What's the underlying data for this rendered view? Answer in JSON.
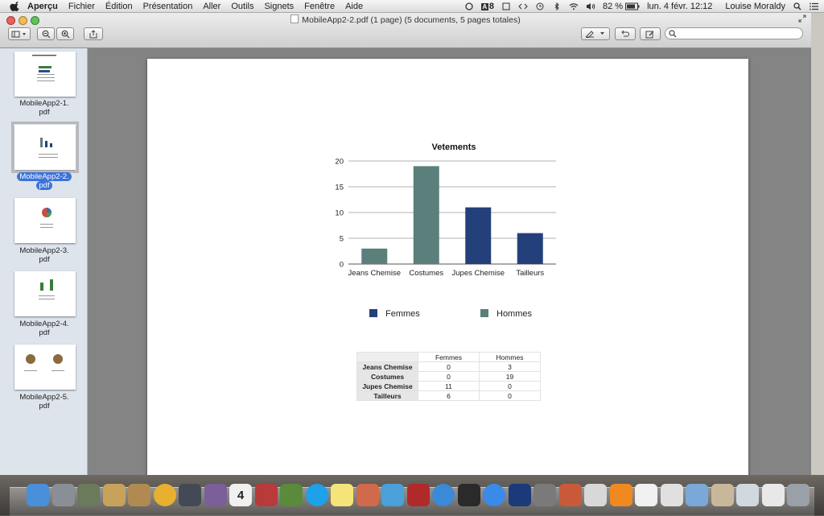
{
  "menubar": {
    "app": "Aperçu",
    "items": [
      "Fichier",
      "Édition",
      "Présentation",
      "Aller",
      "Outils",
      "Signets",
      "Fenêtre",
      "Aide"
    ],
    "status": {
      "badge": "8",
      "battery": "82 %",
      "datetime": "lun. 4 févr.  12:12",
      "user": "Louise Moraldy"
    }
  },
  "window": {
    "title": "MobileApp2-2.pdf (1 page) (5 documents, 5 pages totales)"
  },
  "sidebar": {
    "items": [
      {
        "label_line1": "MobileApp2-1.",
        "label_line2": "pdf"
      },
      {
        "label_line1": "MobileApp2-2.",
        "label_line2": "pdf"
      },
      {
        "label_line1": "MobileApp2-3.",
        "label_line2": "pdf"
      },
      {
        "label_line1": "MobileApp2-4.",
        "label_line2": "pdf"
      },
      {
        "label_line1": "MobileApp2-5.",
        "label_line2": "pdf"
      }
    ],
    "selected_index": 1
  },
  "chart_data": {
    "type": "bar",
    "title": "Vetements",
    "categories": [
      "Jeans Chemise",
      "Costumes",
      "Jupes Chemise",
      "Tailleurs"
    ],
    "series": [
      {
        "name": "Femmes",
        "values": [
          0,
          0,
          11,
          6
        ],
        "color": "#24407a"
      },
      {
        "name": "Hommes",
        "values": [
          3,
          19,
          0,
          0
        ],
        "color": "#5b7f7b"
      }
    ],
    "ylim": [
      0,
      20
    ],
    "yticks": [
      0,
      5,
      10,
      15,
      20
    ],
    "grid": true,
    "legend": "bottom"
  },
  "table": {
    "headers": [
      "Femmes",
      "Hommes"
    ],
    "rows": [
      {
        "label": "Jeans Chemise",
        "values": [
          "0",
          "3"
        ]
      },
      {
        "label": "Costumes",
        "values": [
          "0",
          "19"
        ]
      },
      {
        "label": "Jupes Chemise",
        "values": [
          "11",
          "0"
        ]
      },
      {
        "label": "Tailleurs",
        "values": [
          "6",
          "0"
        ]
      }
    ]
  },
  "dock": {
    "icons": [
      "finder-icon",
      "launchpad-icon",
      "app-icon",
      "preview-icon",
      "app-icon",
      "chrome-icon",
      "app-icon",
      "app-icon",
      "calendar-icon",
      "app-icon",
      "app-icon",
      "skype-icon",
      "notes-icon",
      "app-icon",
      "app-icon",
      "photobooth-icon",
      "itunes-icon",
      "app-icon",
      "appstore-icon",
      "photoshop-icon",
      "app-icon",
      "app-icon",
      "app-icon",
      "vlc-icon",
      "app-icon",
      "documents-icon",
      "folder-icon",
      "app-icon",
      "app-icon",
      "app-icon",
      "trash-icon"
    ],
    "calendar_day": "4"
  }
}
